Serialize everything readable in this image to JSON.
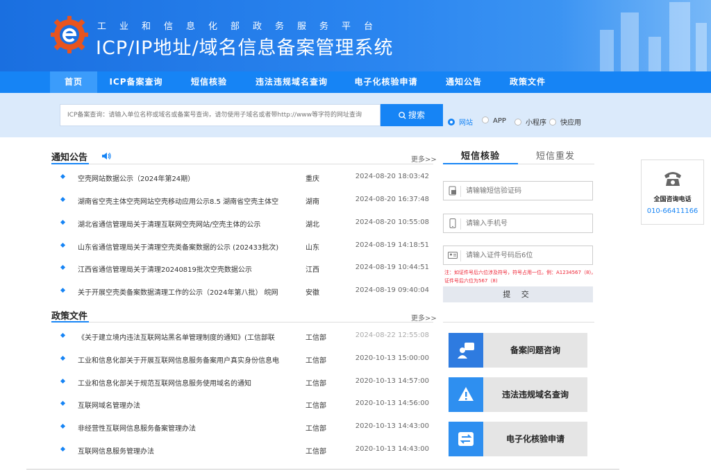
{
  "header": {
    "slogan": "工业和信息化部政务服务平台",
    "title": "ICP/IP地址/域名信息备案管理系统"
  },
  "nav": {
    "items": [
      "首页",
      "ICP备案查询",
      "短信核验",
      "违法违规域名查询",
      "电子化核验申请",
      "通知公告",
      "政策文件"
    ]
  },
  "search": {
    "placeholder": "ICP备案查询：请输入单位名称或域名或备案号查询，请勿使用子域名或者带http://www等字符的网址查询",
    "button_label": "搜索",
    "types": [
      "网站",
      "APP",
      "小程序",
      "快应用"
    ],
    "selected": "网站"
  },
  "notices": {
    "title": "通知公告",
    "more": "更多>>",
    "items": [
      {
        "title": "空壳网站数据公示（2024年第24期）",
        "region": "重庆",
        "date": "2024-08-20 18:03:42"
      },
      {
        "title": "湖南省空壳主体空壳网站空壳移动应用公示8.5 湖南省空壳主体空",
        "region": "湖南",
        "date": "2024-08-20 16:37:48"
      },
      {
        "title": "湖北省通信管理局关于清理互联网空壳网站/空壳主体的公示",
        "region": "湖北",
        "date": "2024-08-20 10:55:08"
      },
      {
        "title": "山东省通信管理局关于清理空壳类备案数据的公示 (202433批次)",
        "region": "山东",
        "date": "2024-08-19 14:18:51"
      },
      {
        "title": "江西省通信管理局关于清理20240819批次空壳数据公示",
        "region": "江西",
        "date": "2024-08-19 10:44:51"
      },
      {
        "title": "关于开展空壳类备案数据清理工作的公示（2024年第八批） 皖网",
        "region": "安徽",
        "date": "2024-08-19 09:40:04"
      }
    ]
  },
  "policies": {
    "title": "政策文件",
    "more": "更多>>",
    "items": [
      {
        "title": "《关于建立境内违法互联网站黑名单管理制度的通知》(工信部联",
        "region": "工信部",
        "date": "2024-08-22 12:55:08"
      },
      {
        "title": "工业和信息化部关于开展互联网信息服务备案用户真实身份信息电",
        "region": "工信部",
        "date": "2020-10-13 15:00:00"
      },
      {
        "title": "工业和信息化部关于规范互联网信息服务使用域名的通知",
        "region": "工信部",
        "date": "2020-10-13 14:57:00"
      },
      {
        "title": "互联网域名管理办法",
        "region": "工信部",
        "date": "2020-10-13 14:56:00"
      },
      {
        "title": "非经营性互联网信息服务备案管理办法",
        "region": "工信部",
        "date": "2020-10-13 14:43:00"
      },
      {
        "title": "互联网信息服务管理办法",
        "region": "工信部",
        "date": "2020-10-13 14:43:00"
      }
    ]
  },
  "sms_panel": {
    "tabs": [
      "短信核验",
      "短信重发"
    ],
    "active_tab": "短信核验",
    "fields": [
      {
        "icon": "sms-code-icon",
        "placeholder": "请输输短信验证码"
      },
      {
        "icon": "mobile-phone-icon",
        "placeholder": "请输入手机号"
      },
      {
        "icon": "id-card-icon",
        "placeholder": "请输入证件号码后6位"
      }
    ],
    "note": "注：如证件号后六位涉及符号，符号占用一位。例：A1234567（8)，证件号后六位为567（8)",
    "submit_label": "提 交"
  },
  "quick_links": [
    {
      "label": "备案问题咨询",
      "icon": "consult-icon",
      "color": "#2e7be0"
    },
    {
      "label": "违法违规域名查询",
      "icon": "warning-icon",
      "color": "#2e8ff0"
    },
    {
      "label": "电子化核验申请",
      "icon": "transfer-icon",
      "color": "#2e8ff0"
    }
  ],
  "hotline": {
    "label": "全国咨询电话",
    "phone": "010-66411166"
  },
  "colors": {
    "primary": "#1684f5",
    "header_dark": "#1a6fe0",
    "note_red": "#e22233"
  }
}
